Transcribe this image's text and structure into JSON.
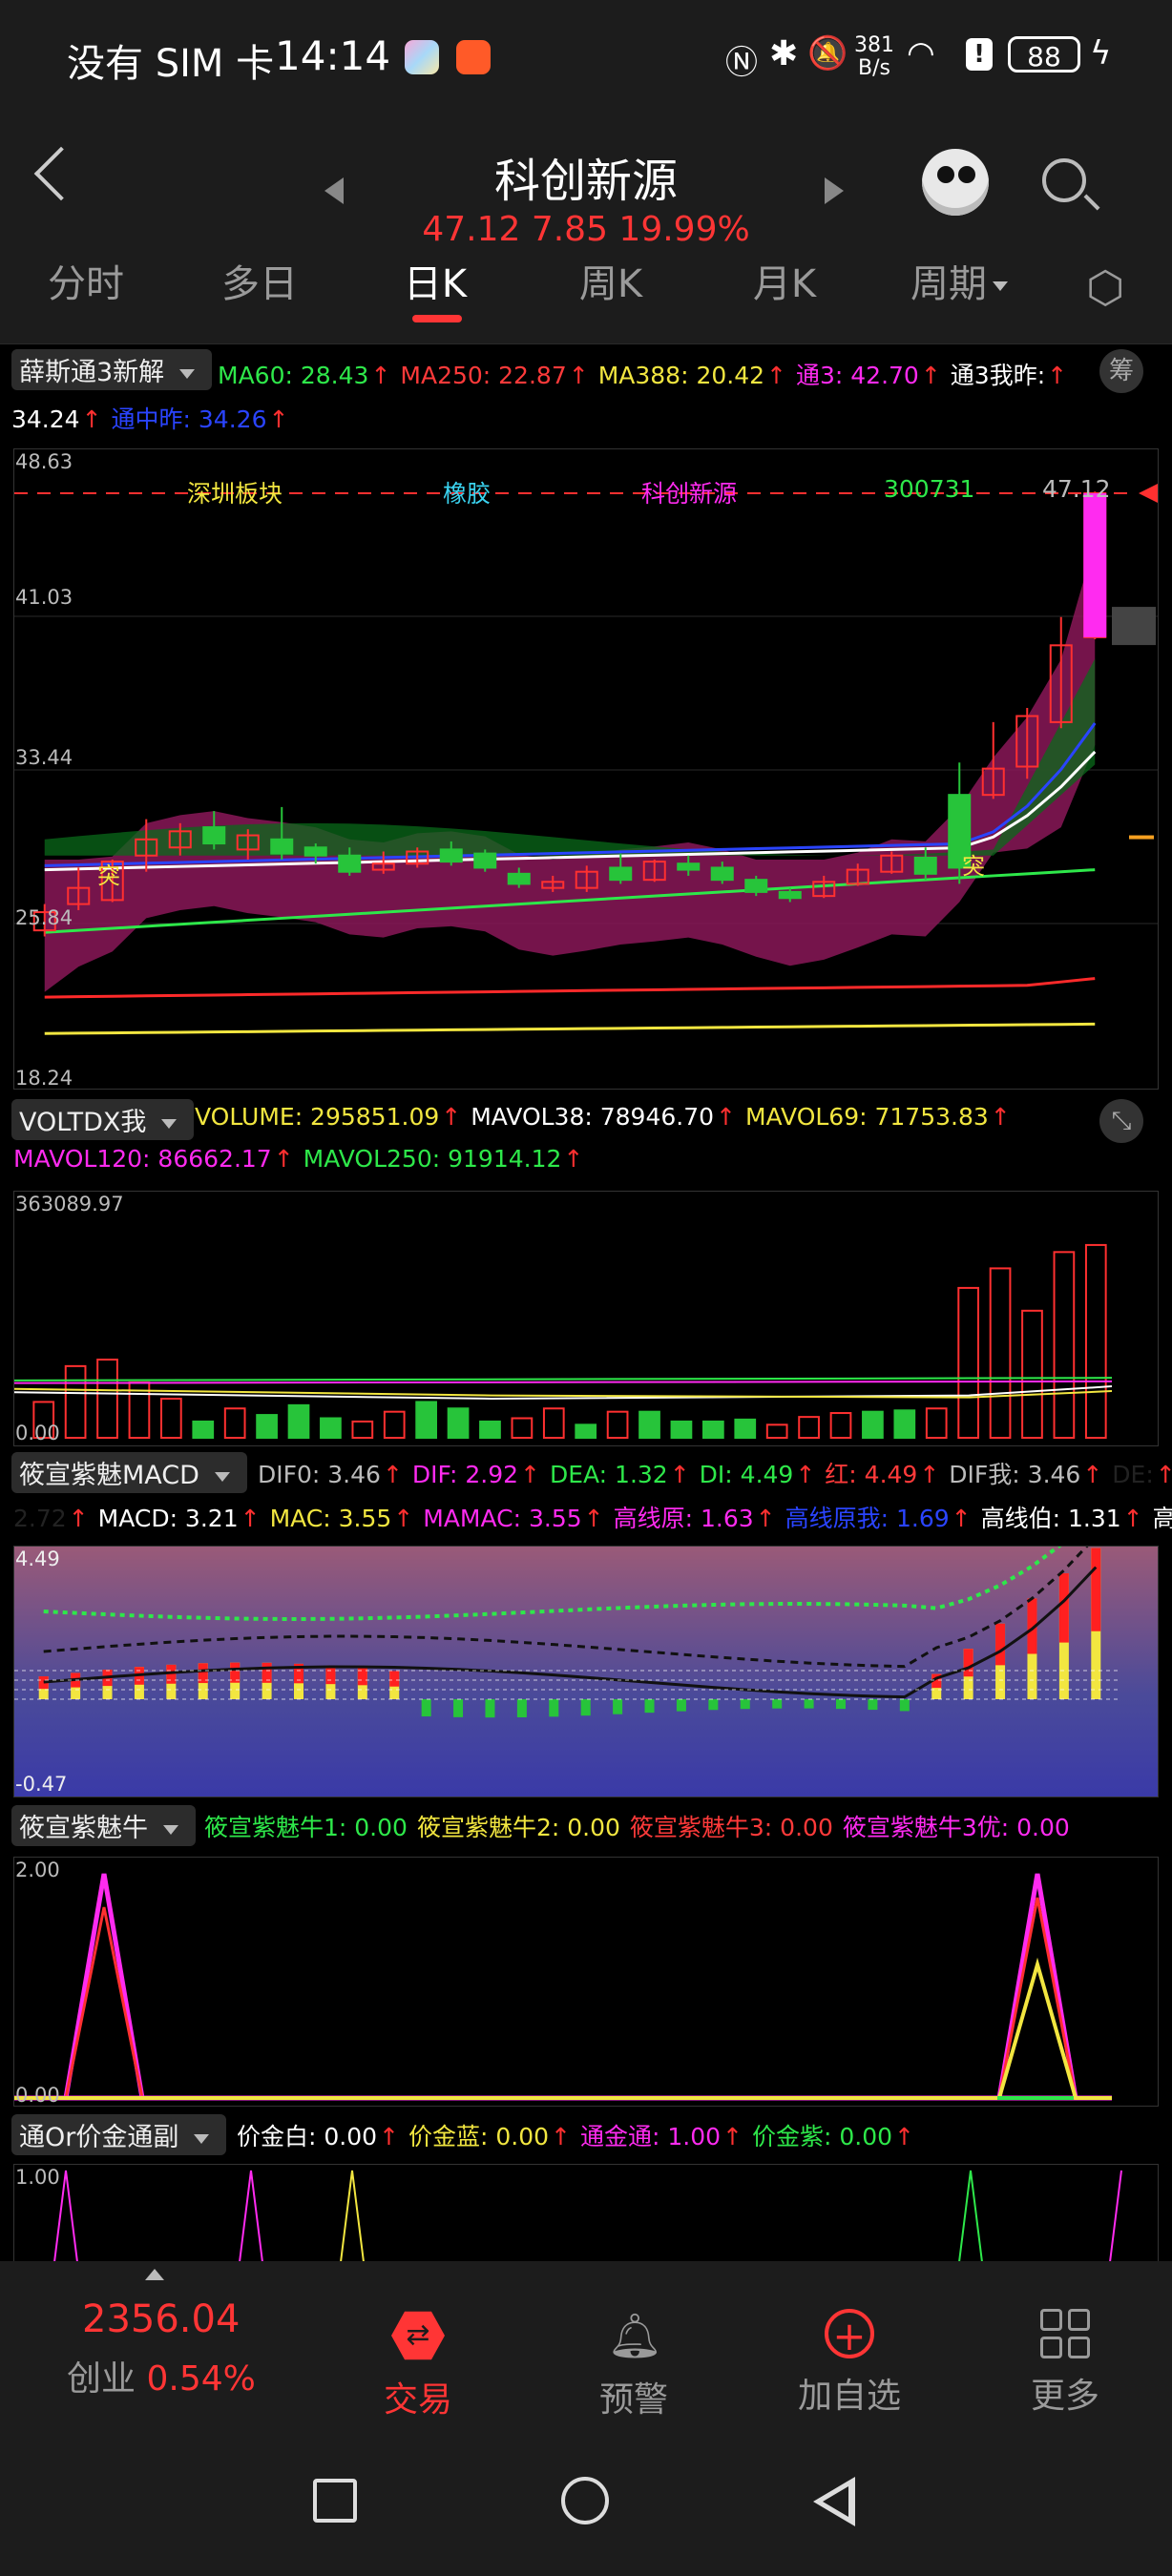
{
  "status": {
    "carrier": "没有 SIM 卡",
    "time": "14:14",
    "net_speed_top": "381",
    "net_speed_bottom": "B/s",
    "battery": "88"
  },
  "header": {
    "stock_name": "科创新源",
    "price_line": "47.12 7.85 19.99%"
  },
  "tabs": [
    {
      "label": "分时"
    },
    {
      "label": "多日"
    },
    {
      "label": "日K",
      "active": true
    },
    {
      "label": "周K"
    },
    {
      "label": "月K"
    },
    {
      "label": "周期"
    }
  ],
  "main_indicator": {
    "selector": "薛斯通3新解",
    "items": [
      {
        "text": "MA60: 28.43",
        "color": "#2ee84a"
      },
      {
        "text": "MA250: 22.87",
        "color": "#ff3a3a"
      },
      {
        "text": "MA388: 20.42",
        "color": "#f2e640"
      },
      {
        "text": "通3: 42.70",
        "color": "#ff2bf0"
      },
      {
        "text": "通3我昨:",
        "color": "#ffffff"
      }
    ],
    "items2": [
      {
        "text": "34.24",
        "color": "#ffffff"
      },
      {
        "text": "通中昨: 34.26",
        "color": "#2a44ff"
      }
    ],
    "badge": "筹",
    "axis": [
      "48.63",
      "41.03",
      "33.44",
      "25.84",
      "18.24"
    ],
    "tags": [
      {
        "text": "深圳板块",
        "color": "#f2e640"
      },
      {
        "text": "橡胶",
        "color": "#3ad3f0"
      },
      {
        "text": "科创新源",
        "color": "#ff2bf0"
      },
      {
        "text": "300731",
        "color": "#2ee84a"
      }
    ],
    "last_price": "47.12",
    "marker_text": "突"
  },
  "volume_indicator": {
    "selector": "VOLTDX我",
    "items": [
      {
        "text": "VOLUME: 295851.09",
        "color": "#f2e640"
      },
      {
        "text": "MAVOL38: 78946.70",
        "color": "#ffffff"
      },
      {
        "text": "MAVOL69: 71753.83",
        "color": "#f2e640"
      }
    ],
    "items2": [
      {
        "text": "MAVOL120: 86662.17",
        "color": "#ff2bf0"
      },
      {
        "text": "MAVOL250: 91914.12",
        "color": "#2ee84a"
      }
    ],
    "axis_top": "363089.97",
    "axis_bottom": "0.00"
  },
  "macd_indicator": {
    "selector": "筱宣紫魅MACD",
    "items": [
      {
        "text": "DIF0: 3.46",
        "color": "#bbbbbb"
      },
      {
        "text": "DIF: 2.92",
        "color": "#ff2bf0"
      },
      {
        "text": "DEA: 1.32",
        "color": "#2ee84a"
      },
      {
        "text": "DI: 4.49",
        "color": "#2ee84a"
      },
      {
        "text": "红: 4.49",
        "color": "#ff3a3a"
      },
      {
        "text": "DIF我: 3.46",
        "color": "#bbbbbb"
      },
      {
        "text": "DE:",
        "color": "#222222"
      }
    ],
    "items2": [
      {
        "text": "2.72",
        "color": "#222222"
      },
      {
        "text": "MACD: 3.21",
        "color": "#ffffff"
      },
      {
        "text": "MAC: 3.55",
        "color": "#f2e640"
      },
      {
        "text": "MAMAC: 3.55",
        "color": "#ff2bf0"
      },
      {
        "text": "高线原: 1.63",
        "color": "#ff2bf0"
      },
      {
        "text": "高线原我: 1.69",
        "color": "#2a44ff"
      },
      {
        "text": "高线伯: 1.31",
        "color": "#ffffff"
      },
      {
        "text": "高",
        "color": "#ffffff"
      }
    ],
    "axis_top": "4.49",
    "axis_bottom": "-0.47"
  },
  "niu_indicator": {
    "selector": "筱宣紫魅牛",
    "items": [
      {
        "text": "筱宣紫魅牛1: 0.00",
        "color": "#2ee84a"
      },
      {
        "text": "筱宣紫魅牛2: 0.00",
        "color": "#f2e640"
      },
      {
        "text": "筱宣紫魅牛3: 0.00",
        "color": "#ff3a3a"
      },
      {
        "text": "筱宣紫魅牛3优: 0.00",
        "color": "#ff2bf0"
      }
    ],
    "axis_top": "2.00",
    "axis_bottom": "0.00"
  },
  "gold_indicator": {
    "selector": "通Or价金通副",
    "items": [
      {
        "text": "价金白: 0.00",
        "color": "#ffffff"
      },
      {
        "text": "价金蓝: 0.00",
        "color": "#f2e640"
      },
      {
        "text": "通金通: 1.00",
        "color": "#ff2bf0"
      },
      {
        "text": "价金紫: 0.00",
        "color": "#2ee84a"
      }
    ],
    "axis_top": "1.00"
  },
  "bottom": {
    "index_value": "2356.04",
    "index_name": "创业",
    "index_change": "0.54%",
    "items": [
      {
        "label": "交易",
        "active": true
      },
      {
        "label": "预警"
      },
      {
        "label": "加自选"
      },
      {
        "label": "更多"
      }
    ]
  },
  "chart_data": {
    "type": "candlestick",
    "ylim": [
      18.24,
      48.63
    ],
    "candles": [
      {
        "o": 25.5,
        "c": 26.4,
        "h": 26.8,
        "l": 25.2
      },
      {
        "o": 26.8,
        "c": 27.6,
        "h": 28.6,
        "l": 26.5
      },
      {
        "o": 27.0,
        "c": 28.9,
        "h": 29.0,
        "l": 26.9
      },
      {
        "o": 29.2,
        "c": 30.0,
        "h": 31.0,
        "l": 28.4
      },
      {
        "o": 29.6,
        "c": 30.4,
        "h": 30.8,
        "l": 29.2
      },
      {
        "o": 30.6,
        "c": 29.8,
        "h": 31.4,
        "l": 29.5
      },
      {
        "o": 29.5,
        "c": 30.2,
        "h": 30.5,
        "l": 29.0
      },
      {
        "o": 30.0,
        "c": 29.3,
        "h": 31.6,
        "l": 29.0
      },
      {
        "o": 29.6,
        "c": 29.2,
        "h": 29.8,
        "l": 28.8
      },
      {
        "o": 29.2,
        "c": 28.4,
        "h": 29.6,
        "l": 28.2
      },
      {
        "o": 28.5,
        "c": 28.8,
        "h": 29.4,
        "l": 28.3
      },
      {
        "o": 28.8,
        "c": 29.4,
        "h": 29.6,
        "l": 28.6
      },
      {
        "o": 29.5,
        "c": 28.9,
        "h": 29.9,
        "l": 28.7
      },
      {
        "o": 29.3,
        "c": 28.6,
        "h": 29.5,
        "l": 28.4
      },
      {
        "o": 28.3,
        "c": 27.8,
        "h": 28.6,
        "l": 27.6
      },
      {
        "o": 27.6,
        "c": 27.9,
        "h": 28.2,
        "l": 27.4
      },
      {
        "o": 27.6,
        "c": 28.4,
        "h": 28.7,
        "l": 27.4
      },
      {
        "o": 28.6,
        "c": 28.0,
        "h": 29.3,
        "l": 27.8
      },
      {
        "o": 28.0,
        "c": 28.9,
        "h": 29.0,
        "l": 27.9
      },
      {
        "o": 28.8,
        "c": 28.5,
        "h": 29.2,
        "l": 28.2
      },
      {
        "o": 28.6,
        "c": 28.0,
        "h": 28.9,
        "l": 27.8
      },
      {
        "o": 28.0,
        "c": 27.4,
        "h": 28.2,
        "l": 27.2
      },
      {
        "o": 27.4,
        "c": 27.1,
        "h": 27.6,
        "l": 26.9
      },
      {
        "o": 27.2,
        "c": 27.9,
        "h": 28.2,
        "l": 27.1
      },
      {
        "o": 27.8,
        "c": 28.5,
        "h": 28.8,
        "l": 27.7
      },
      {
        "o": 28.4,
        "c": 29.2,
        "h": 29.4,
        "l": 28.3
      },
      {
        "o": 29.1,
        "c": 28.3,
        "h": 29.6,
        "l": 28.0
      },
      {
        "o": 32.2,
        "c": 28.6,
        "h": 33.8,
        "l": 27.8
      },
      {
        "o": 32.2,
        "c": 33.5,
        "h": 35.8,
        "l": 32.0
      },
      {
        "o": 33.6,
        "c": 36.1,
        "h": 36.5,
        "l": 33.0
      },
      {
        "o": 35.8,
        "c": 39.6,
        "h": 41.0,
        "l": 35.5
      },
      {
        "o": 40.0,
        "c": 47.12,
        "h": 47.2,
        "l": 39.9
      }
    ],
    "volume": [
      55000,
      110000,
      120000,
      85000,
      60000,
      25000,
      45000,
      35000,
      50000,
      30000,
      25000,
      40000,
      55000,
      45000,
      25000,
      30000,
      45000,
      20000,
      40000,
      40000,
      25000,
      25000,
      28000,
      20000,
      32000,
      38000,
      40000,
      42000,
      45000,
      230000,
      260000,
      195000,
      285000,
      295851.09
    ]
  }
}
